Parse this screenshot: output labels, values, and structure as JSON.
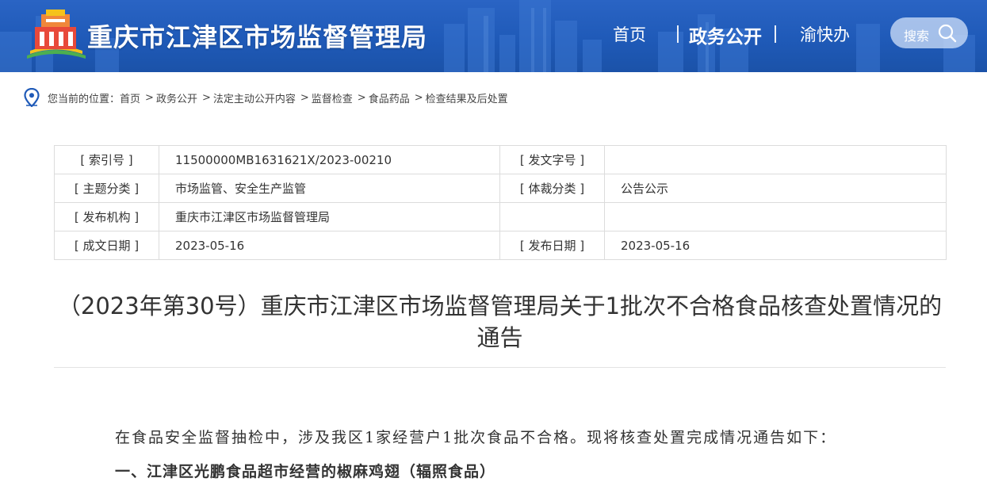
{
  "header": {
    "site_title": "重庆市江津区市场监督管理局",
    "nav": [
      {
        "label": "首页"
      },
      {
        "label": "政务公开"
      },
      {
        "label": "渝快办"
      }
    ],
    "search_label": "搜索",
    "brand_color": "#2160bd"
  },
  "breadcrumb": {
    "prefix": "您当前的位置：",
    "items": [
      "首页",
      "政务公开",
      "法定主动公开内容",
      "监督检查",
      "食品药品",
      "检查结果及后处置"
    ],
    "separator": ">"
  },
  "meta": {
    "index_label": "[ 索引号 ]",
    "index_value": "11500000MB1631621X/2023-00210",
    "docno_label": "[ 发文字号 ]",
    "docno_value": "",
    "topic_label": "[ 主题分类 ]",
    "topic_value": "市场监管、安全生产监管",
    "genre_label": "[ 体裁分类 ]",
    "genre_value": "公告公示",
    "org_label": "[ 发布机构 ]",
    "org_value": "重庆市江津区市场监督管理局",
    "created_label": "[ 成文日期 ]",
    "created_value": "2023-05-16",
    "published_label": "[ 发布日期 ]",
    "published_value": "2023-05-16"
  },
  "article": {
    "title": "（2023年第30号）重庆市江津区市场监督管理局关于1批次不合格食品核查处置情况的通告",
    "intro": "在食品安全监督抽检中，涉及我区1家经营户1批次食品不合格。现将核查处置完成情况通告如下：",
    "section1": "一、江津区光鹏食品超市经营的椒麻鸡翅（辐照食品）"
  }
}
